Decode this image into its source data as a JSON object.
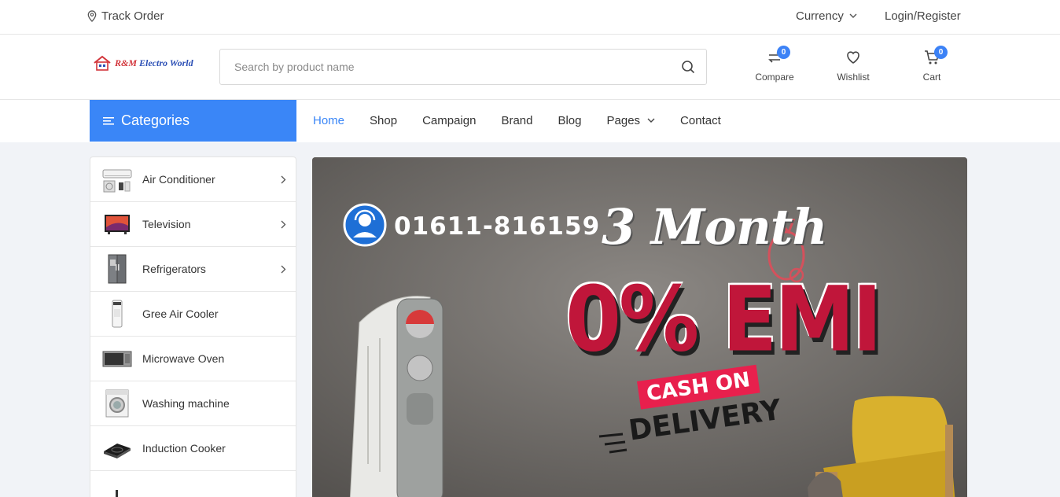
{
  "topbar": {
    "track_order": "Track Order",
    "currency": "Currency",
    "login_register": "Login/Register"
  },
  "header": {
    "logo": {
      "brand_prefix": "R&M",
      "brand_suffix": "Electro World"
    },
    "search": {
      "placeholder": "Search by product name",
      "value": ""
    },
    "compare": {
      "label": "Compare",
      "count": "0"
    },
    "wishlist": {
      "label": "Wishlist"
    },
    "cart": {
      "label": "Cart",
      "count": "0"
    }
  },
  "nav": {
    "categories_label": "Categories",
    "links": [
      {
        "label": "Home",
        "active": true
      },
      {
        "label": "Shop"
      },
      {
        "label": "Campaign"
      },
      {
        "label": "Brand"
      },
      {
        "label": "Blog"
      },
      {
        "label": "Pages",
        "has_dropdown": true
      },
      {
        "label": "Contact"
      }
    ]
  },
  "sidebar": {
    "items": [
      {
        "label": "Air Conditioner",
        "icon": "air-conditioner-icon",
        "has_submenu": true
      },
      {
        "label": "Television",
        "icon": "television-icon",
        "has_submenu": true
      },
      {
        "label": "Refrigerators",
        "icon": "refrigerator-icon",
        "has_submenu": true
      },
      {
        "label": "Gree Air Cooler",
        "icon": "air-cooler-icon",
        "has_submenu": false
      },
      {
        "label": "Microwave Oven",
        "icon": "microwave-icon",
        "has_submenu": false
      },
      {
        "label": "Washing machine",
        "icon": "washing-machine-icon",
        "has_submenu": false
      },
      {
        "label": "Induction Cooker",
        "icon": "induction-cooker-icon",
        "has_submenu": false
      },
      {
        "label": "",
        "icon": "partial-item-icon",
        "has_submenu": false
      }
    ]
  },
  "banner": {
    "phone": "01611-816159",
    "headline": "3 Month",
    "offer": "0% EMI",
    "cash_on": "CASH ON",
    "delivery": "DELIVERY",
    "colors": {
      "offer": "#c0163a",
      "cash_badge": "#e8204d",
      "accent": "#3a86f7"
    }
  }
}
